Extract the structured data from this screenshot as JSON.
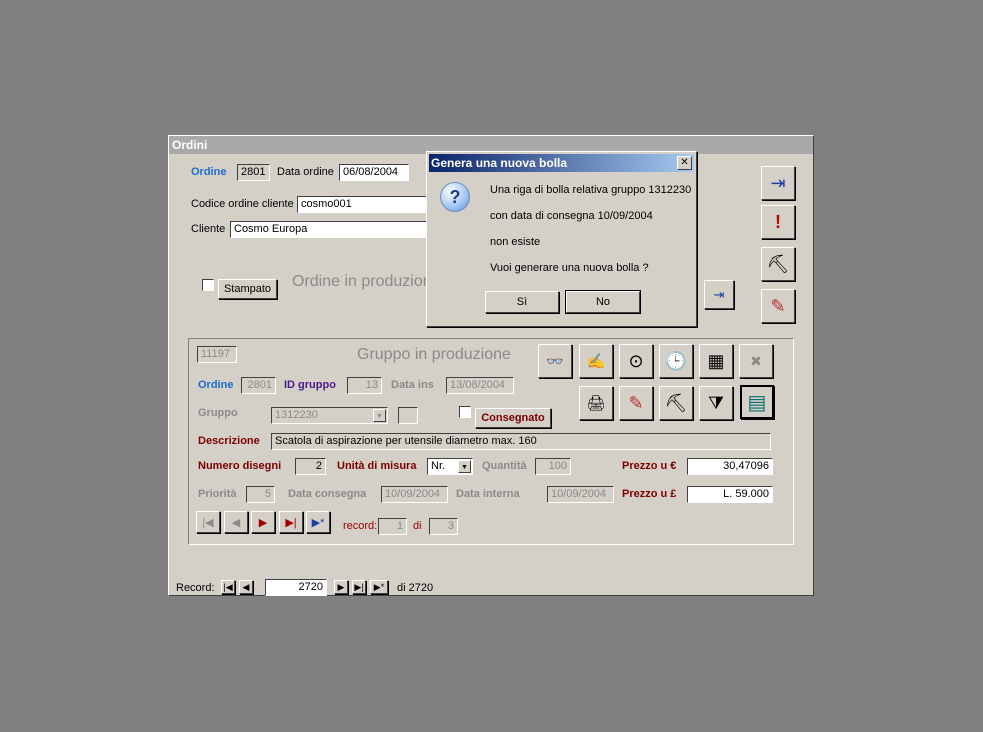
{
  "window": {
    "title": "Ordini"
  },
  "order": {
    "ordine_label": "Ordine",
    "ordine_value": "2801",
    "data_ordine_label": "Data ordine",
    "data_ordine_value": "06/08/2004",
    "codice_label": "Codice ordine cliente",
    "codice_value": "cosmo001",
    "cliente_label": "Cliente",
    "cliente_value": "Cosmo Europa",
    "stampato_label": "Stampato",
    "status_text": "Ordine in produzion"
  },
  "group": {
    "id_value": "11197",
    "title": "Gruppo in produzione",
    "ordine_label": "Ordine",
    "ordine_value": "2801",
    "id_gruppo_label": "ID gruppo",
    "id_gruppo_value": "13",
    "data_ins_label": "Data ins",
    "data_ins_value": "13/08/2004",
    "gruppo_label": "Gruppo",
    "gruppo_value": "1312230",
    "consegnato_label": "Consegnato",
    "descrizione_label": "Descrizione",
    "descrizione_value": "Scatola di aspirazione per utensile diametro max. 160",
    "numero_disegni_label": "Numero disegni",
    "numero_disegni_value": "2",
    "unita_label": "Unità di misura",
    "unita_value": "Nr.",
    "quantita_label": "Quantità",
    "quantita_value": "100",
    "prezzo_eur_label": "Prezzo u €",
    "prezzo_eur_value": "30,47096",
    "priorita_label": "Priorità",
    "priorita_value": "5",
    "data_consegna_label": "Data consegna",
    "data_consegna_value": "10/09/2004",
    "data_interna_label": "Data interna",
    "data_interna_value": "10/09/2004",
    "prezzo_lire_label": "Prezzo u £",
    "prezzo_lire_value": "L. 59.000",
    "record_label": "record:",
    "record_value": "1",
    "di_label": "di",
    "di_value": "3"
  },
  "record_bar": {
    "label": "Record:",
    "value": "2720",
    "total": "di 2720"
  },
  "dialog": {
    "title": "Genera una nuova bolla",
    "line1": "Una riga di bolla relativa gruppo 1312230",
    "line2": "con data di consegna 10/09/2004",
    "line3": "non esiste",
    "line4": "Vuoi generare una nuova bolla  ?",
    "yes_label": "Sì",
    "no_label": "No",
    "close_glyph": "✕",
    "question_glyph": "?"
  },
  "icons": {
    "exit": "⇥",
    "alert": "!",
    "pick": "⛏",
    "pencil": "✎",
    "import": "⇥",
    "glasses": "👓",
    "edit": "✍",
    "clock_small": "⊙",
    "clock": "🕒",
    "calendar": "▦",
    "cancel": "✖",
    "print": "🖨",
    "filter": "⧩",
    "notebook": "▤",
    "first": "|◀",
    "prev": "◀",
    "next": "▶",
    "last": "▶|",
    "new": "▶*",
    "dropdown": "▼"
  },
  "colors": {
    "accent_blue": "#1a6ec9",
    "maroon": "#7b0000",
    "purple": "#4b1a8f"
  }
}
